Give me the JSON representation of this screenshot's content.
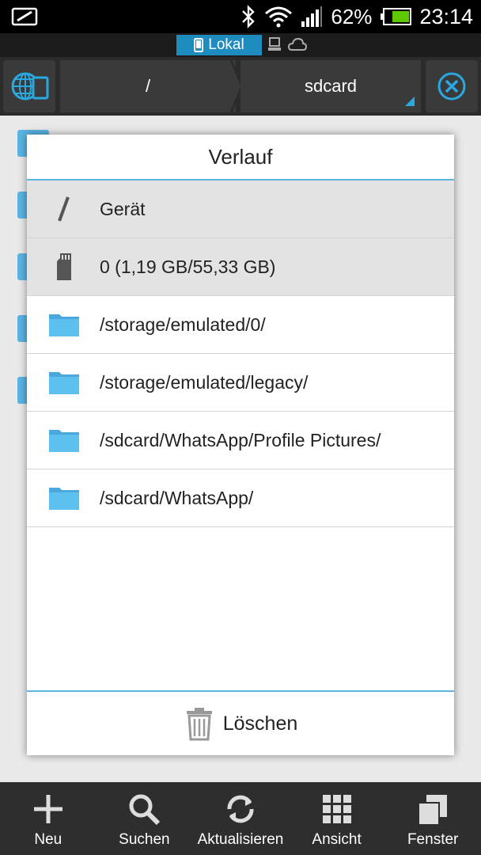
{
  "status_bar": {
    "battery_percent": "62%",
    "time": "23:14",
    "icons": [
      "screenshot-icon",
      "bluetooth-icon",
      "wifi-icon",
      "signal-icon",
      "battery-icon"
    ]
  },
  "location_tabs": {
    "active_label": "Lokal",
    "other_icons": [
      "network-icon",
      "cloud-icon"
    ]
  },
  "toolbar": {
    "left_icon": "globe-device-icon",
    "path_segments": [
      "/",
      "sdcard"
    ],
    "right_icon": "close-circle-icon"
  },
  "dialog": {
    "title": "Verlauf",
    "items": [
      {
        "icon": "slash-icon",
        "label": "Gerät"
      },
      {
        "icon": "sdcard-icon",
        "label": "0 (1,19 GB/55,33 GB)"
      },
      {
        "icon": "folder-icon",
        "label": "/storage/emulated/0/"
      },
      {
        "icon": "folder-icon",
        "label": "/storage/emulated/legacy/"
      },
      {
        "icon": "folder-icon",
        "label": "/sdcard/WhatsApp/Profile Pictures/"
      },
      {
        "icon": "folder-icon",
        "label": "/sdcard/WhatsApp/"
      }
    ],
    "footer_label": "Löschen",
    "footer_icon": "trash-icon"
  },
  "bottom_nav": [
    {
      "icon": "plus-icon",
      "label": "Neu"
    },
    {
      "icon": "search-icon",
      "label": "Suchen"
    },
    {
      "icon": "refresh-icon",
      "label": "Aktualisieren"
    },
    {
      "icon": "grid-icon",
      "label": "Ansicht"
    },
    {
      "icon": "windows-icon",
      "label": "Fenster"
    }
  ],
  "colors": {
    "accent": "#1f8cc0",
    "folder": "#5ab4e4",
    "divider_accent": "#5ab8e0",
    "battery": "#5ec800"
  }
}
